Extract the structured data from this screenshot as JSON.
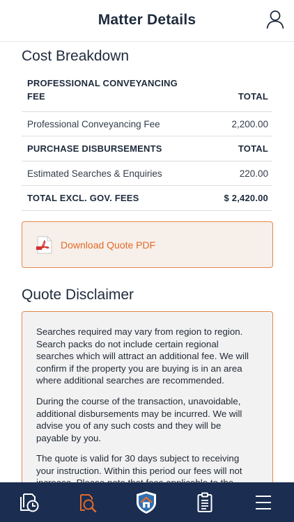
{
  "header": {
    "title": "Matter Details"
  },
  "cost_breakdown": {
    "title": "Cost Breakdown",
    "rows": [
      {
        "type": "head",
        "label_line1": "PROFESSIONAL CONVEYANCING",
        "label_line2": "FEE",
        "value": "TOTAL"
      },
      {
        "type": "item",
        "label": "Professional Conveyancing Fee",
        "value": "2,200.00"
      },
      {
        "type": "head",
        "label": "PURCHASE DISBURSEMENTS",
        "value": "TOTAL"
      },
      {
        "type": "item",
        "label": "Estimated Searches & Enquiries",
        "value": "220.00"
      },
      {
        "type": "head",
        "label": "TOTAL EXCL. GOV. FEES",
        "value": "$ 2,420.00"
      }
    ]
  },
  "download": {
    "label": "Download Quote PDF"
  },
  "disclaimer": {
    "title": "Quote Disclaimer",
    "paragraphs": [
      [
        "Searches required may vary from region to region.",
        "Search packs do not include certain regional",
        "searches which will attract an additional fee. We will",
        "confirm if the property you are buying is in an area",
        "where additional searches are recommended."
      ],
      [
        "During the course of the transaction, unavoidable,",
        "additional disbursements may be incurred. We will",
        "advise you of any such costs and they will be",
        "payable by you."
      ],
      [
        "The quote is valid for 30 days subject to receiving",
        "your instruction. Within this period our fees will not",
        "increase. Please note that fees applicable to the"
      ]
    ]
  },
  "tabbar": {
    "tabs": [
      {
        "icon": "document-clock-icon",
        "active": false
      },
      {
        "icon": "search-document-icon",
        "active": true
      },
      {
        "icon": "house-shield-logo-icon",
        "active": false
      },
      {
        "icon": "clipboard-list-icon",
        "active": false
      },
      {
        "icon": "menu-icon",
        "active": false
      }
    ]
  },
  "colors": {
    "accent": "#e06a2b",
    "tabbar_bg": "#1b2d50",
    "heading": "#1e2b3c"
  }
}
